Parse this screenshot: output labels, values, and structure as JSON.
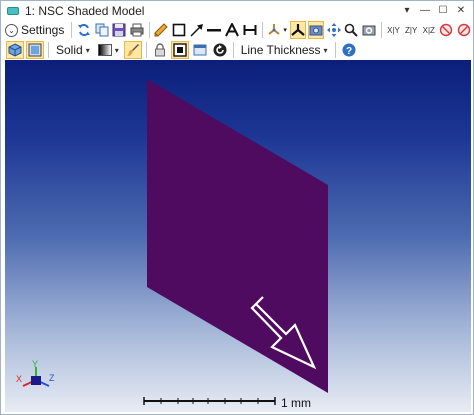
{
  "window": {
    "title": "1: NSC Shaded Model",
    "controls": [
      "▾",
      "—",
      "☐",
      "✕"
    ]
  },
  "toolbar1": {
    "settings_label": "Settings",
    "axis_labels": [
      "X|Y",
      "Z|Y",
      "X|Z"
    ]
  },
  "toolbar2": {
    "solid_label": "Solid",
    "line_thickness_label": "Line Thickness",
    "help_glyph": "?"
  },
  "viewport": {
    "scale_bar_label": "1 mm",
    "triad": {
      "x": "X",
      "y": "Y",
      "z": "Z"
    },
    "colors": {
      "object": "#4f0b5f",
      "background_top": "#0b1f7a",
      "background_bottom": "#e8ecf4"
    }
  }
}
